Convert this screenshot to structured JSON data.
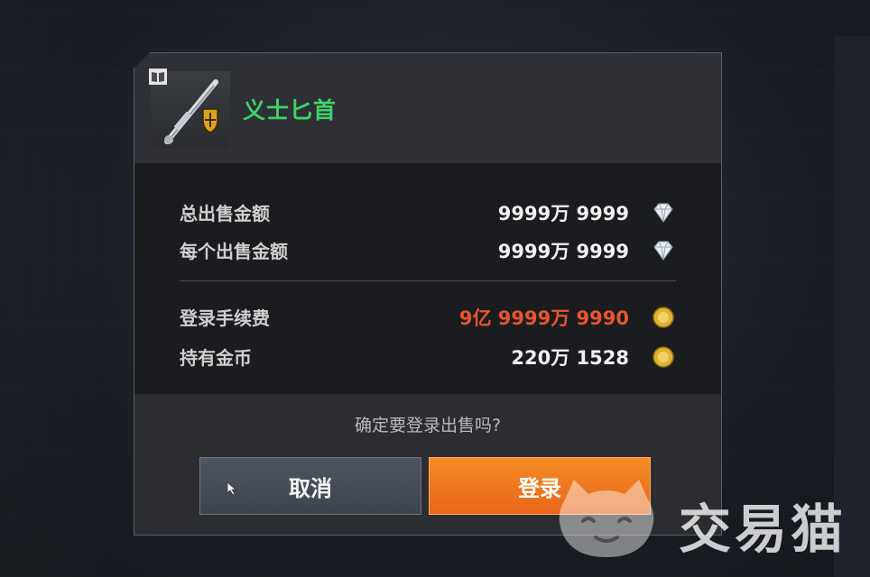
{
  "item": {
    "name": "义士匕首",
    "badge_icon": "book-icon",
    "thumb_icon": "dagger-shield-icon"
  },
  "rows": [
    {
      "label": "总出售金额",
      "value": "9999万 9999",
      "currency": "diamond-icon"
    },
    {
      "label": "每个出售金额",
      "value": "9999万 9999",
      "currency": "diamond-icon"
    },
    {
      "label": "登录手续费",
      "value": "9亿 9999万 9990",
      "currency": "gold-coin-icon",
      "highlight": "#e8552c"
    },
    {
      "label": "持有金币",
      "value": "220万 1528",
      "currency": "gold-coin-icon"
    }
  ],
  "footer": {
    "confirm_text": "确定要登录出售吗?",
    "cancel_label": "取消",
    "login_label": "登录"
  },
  "watermark": {
    "text": "交易猫",
    "icon": "cat-logo-icon"
  },
  "colors": {
    "item_name": "#3fd26a",
    "fee_red": "#e8552c",
    "login_orange": "#f07a20"
  }
}
